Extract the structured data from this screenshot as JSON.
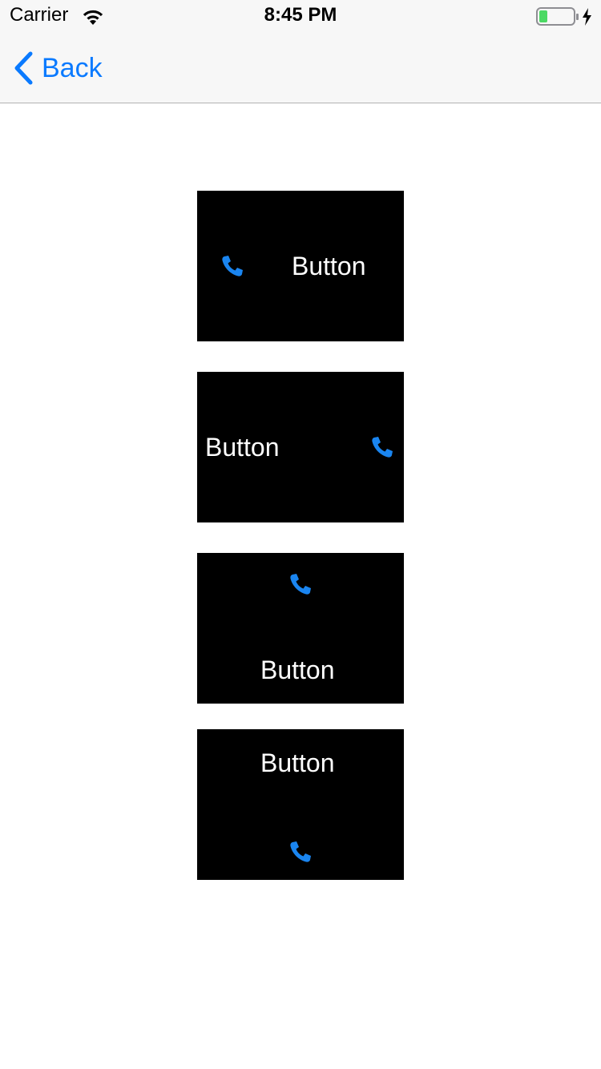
{
  "status_bar": {
    "carrier": "Carrier",
    "time": "8:45 PM",
    "wifi_icon": "wifi-icon",
    "battery_icon": "battery-charging-icon"
  },
  "nav": {
    "back_label": "Back",
    "back_icon": "chevron-left-icon",
    "tint": "#0a7aff"
  },
  "buttons": [
    {
      "label": "Button",
      "icon": "phone-icon",
      "image_position": "left"
    },
    {
      "label": "Button",
      "icon": "phone-icon",
      "image_position": "right"
    },
    {
      "label": "Button",
      "icon": "phone-icon",
      "image_position": "top"
    },
    {
      "label": "Button",
      "icon": "phone-icon",
      "image_position": "bottom"
    }
  ],
  "colors": {
    "button_background": "#000000",
    "button_text": "#ffffff",
    "icon_tint": "#1a85f0",
    "battery_fill": "#4cd964"
  }
}
